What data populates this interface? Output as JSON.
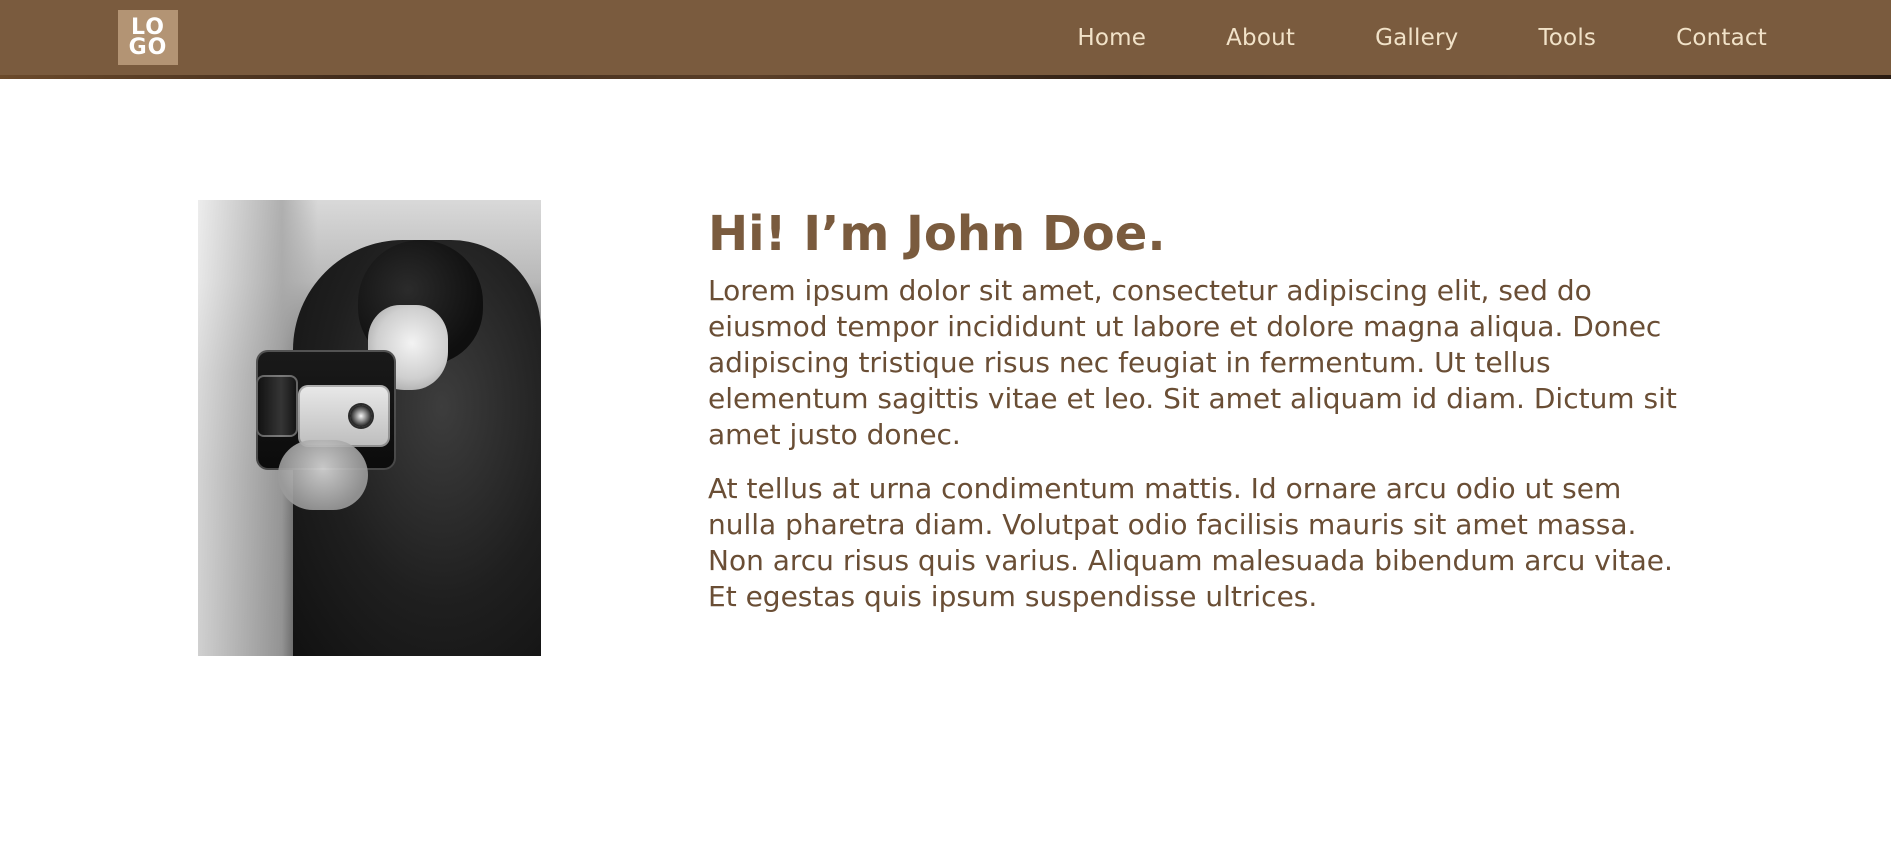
{
  "header": {
    "logo_line1": "LO",
    "logo_line2": "GO",
    "nav_items": [
      "Home",
      "About",
      "Gallery",
      "Tools",
      "Contact"
    ]
  },
  "hero": {
    "title": "Hi! I’m John Doe.",
    "paragraph1": "Lorem ipsum dolor sit amet, consectetur adipiscing elit, sed do eiusmod tempor incididunt ut labore et dolore magna aliqua. Donec adipiscing tristique risus nec feugiat in fermentum. Ut tellus elementum sagittis vitae et leo. Sit amet aliquam id diam. Dictum sit amet justo donec.",
    "paragraph2": "At tellus at urna condimentum mattis. Id ornare arcu odio ut sem nulla pharetra diam. Volutpat odio facilisis mauris sit amet massa. Non arcu risus quis varius. Aliquam malesuada bibendum arcu vitae. Et egestas quis ipsum suspendisse ultrices."
  },
  "colors": {
    "navbar": "#7a5b3e",
    "nav_text": "#f1e2c8",
    "logo_bg": "#b39474",
    "title": "#7a5b3e",
    "body_text": "#6a4e35",
    "page_bg": "#ffffff"
  },
  "icons": {
    "logo": "logo-mark"
  }
}
